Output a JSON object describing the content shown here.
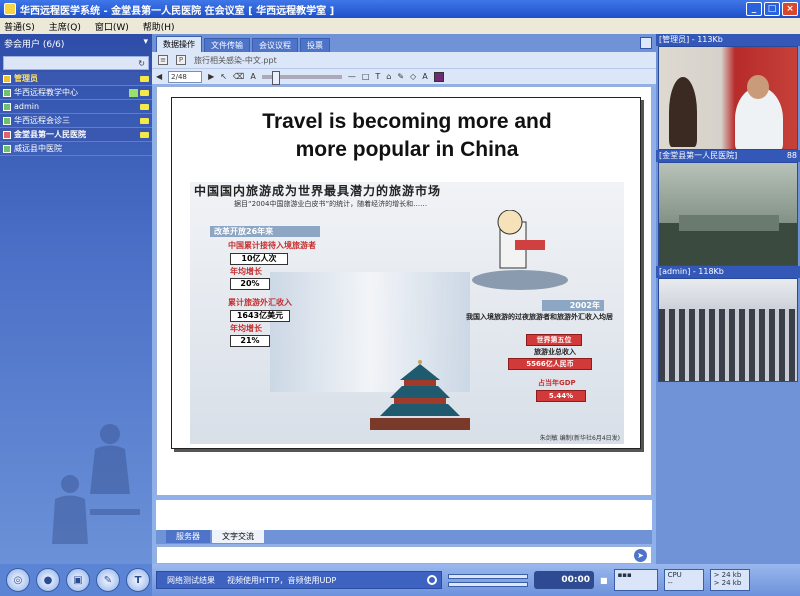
{
  "window": {
    "title": "华西远程医学系统 - 金堂县第一人民医院 在会议室 [ 华西远程教学室 ]"
  },
  "menu": [
    "普通(S)",
    "主席(Q)",
    "窗口(W)",
    "帮助(H)"
  ],
  "participants": {
    "header": "参会用户 (6/6)",
    "users": [
      {
        "name": "管理员",
        "selected": true
      },
      {
        "name": "华西远程教学中心",
        "selected": false
      },
      {
        "name": "admin",
        "selected": false
      },
      {
        "name": "华西远程会诊三",
        "selected": false
      },
      {
        "name": "金堂县第一人民医院",
        "selected": true
      },
      {
        "name": "威远县中医院",
        "selected": false
      }
    ]
  },
  "tabs": [
    "数据操作",
    "文件传输",
    "会议议程",
    "投票"
  ],
  "document": {
    "filename": "旅行相关感染-中文.ppt",
    "page": "2/48"
  },
  "slide": {
    "title_line1": "Travel is becoming more and",
    "title_line2": "more popular in China",
    "headline": "中国国内旅游成为世界最具潜力的旅游市场",
    "subtext": "据目“2004中国旅游业白皮书”的统计，随着经济的增长和……",
    "band1": "改革开放26年来",
    "item1_label": "中国累计接待入境旅游者",
    "item1_value": "10亿人次",
    "item1_growth_label": "年均增长",
    "item1_growth": "20%",
    "item2_label": "累计旅游外汇收入",
    "item2_value": "1643亿美元",
    "item2_growth_label": "年均增长",
    "item2_growth": "21%",
    "band2": "2002年",
    "right_text": "我国入境旅游的过夜旅游者和旅游外汇收入均居",
    "rank": "世界第五位",
    "total_label": "旅游业总收入",
    "total_value": "5566亿人民币",
    "gdp_label": "占当年GDP",
    "gdp_value": "5.44%",
    "credit": "朱剑敏 编制(新华社6月4日发)"
  },
  "bottom_tabs": [
    "服务器",
    "文字交流"
  ],
  "videos": [
    {
      "label": "[管理员] - 113Kb",
      "extra": ""
    },
    {
      "label": "[金堂县第一人民医院]",
      "extra": "88"
    },
    {
      "label": "[admin] - 118Kb",
      "extra": ""
    }
  ],
  "status": {
    "net_test": "网络测试结果",
    "net_detail": "视频使用HTTP，音频使用UDP",
    "timer": "00:00",
    "cpu_label": "CPU",
    "cpu_value": "--",
    "traffic_label": "流量",
    "traffic_up": "> 24 kb",
    "traffic_down": "> 24 kb"
  }
}
